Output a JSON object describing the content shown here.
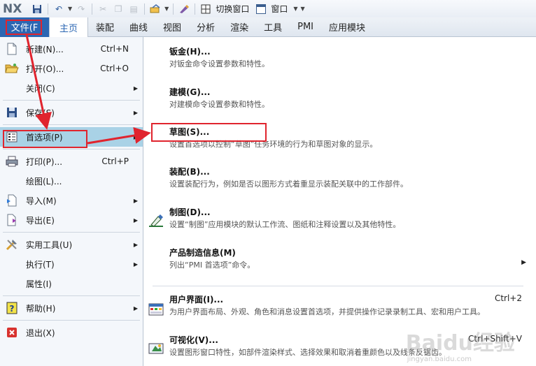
{
  "toolbar": {
    "logo": "NX",
    "switch_window_label": "切换窗口",
    "window_label": "窗口"
  },
  "tabs": {
    "file": "文件(F",
    "items": [
      "主页",
      "装配",
      "曲线",
      "视图",
      "分析",
      "渲染",
      "工具",
      "PMI",
      "应用模块"
    ]
  },
  "file_menu": {
    "items": [
      {
        "label": "新建(N)...",
        "shortcut": "Ctrl+N",
        "icon": "new-document-icon"
      },
      {
        "label": "打开(O)...",
        "shortcut": "Ctrl+O",
        "icon": "open-folder-icon"
      },
      {
        "label": "关闭(C)",
        "shortcut": "",
        "icon": ""
      },
      {
        "label": "保存(S)",
        "shortcut": "",
        "icon": "save-icon"
      },
      {
        "label": "首选项(P)",
        "shortcut": "",
        "icon": "preferences-icon"
      },
      {
        "label": "打印(P)...",
        "shortcut": "Ctrl+P",
        "icon": "print-icon"
      },
      {
        "label": "绘图(L)...",
        "shortcut": "",
        "icon": ""
      },
      {
        "label": "导入(M)",
        "shortcut": "",
        "icon": "import-icon"
      },
      {
        "label": "导出(E)",
        "shortcut": "",
        "icon": "export-icon"
      },
      {
        "label": "实用工具(U)",
        "shortcut": "",
        "icon": "utilities-icon"
      },
      {
        "label": "执行(T)",
        "shortcut": "",
        "icon": ""
      },
      {
        "label": "属性(I)",
        "shortcut": "",
        "icon": ""
      },
      {
        "label": "帮助(H)",
        "shortcut": "",
        "icon": "help-icon"
      },
      {
        "label": "退出(X)",
        "shortcut": "",
        "icon": "exit-icon"
      }
    ]
  },
  "submenu": {
    "items": [
      {
        "title": "钣金(H)...",
        "desc": "对钣金命令设置参数和特性。",
        "shortcut": ""
      },
      {
        "title": "建模(G)...",
        "desc": "对建模命令设置参数和特性。",
        "shortcut": ""
      },
      {
        "title": "草图(S)...",
        "desc": "设置首选项以控制“草图”任务环境的行为和草图对象的显示。",
        "shortcut": ""
      },
      {
        "title": "装配(B)...",
        "desc": "设置装配行为，例如是否以图形方式着重显示装配关联中的工作部件。",
        "shortcut": ""
      },
      {
        "title": "制图(D)...",
        "desc": "设置“制图”应用模块的默认工作流、图纸和注释设置以及其他特性。",
        "shortcut": ""
      },
      {
        "title": "产品制造信息(M)",
        "desc": "列出“PMI 首选项”命令。",
        "shortcut": ""
      },
      {
        "title": "用户界面(I)...",
        "desc": "为用户界面布局、外观、角色和消息设置首选项，并提供操作记录录制工具、宏和用户工具。",
        "shortcut": "Ctrl+2"
      },
      {
        "title": "可视化(V)...",
        "desc": "设置图形窗口特性，如部件渲染样式、选择效果和取消着重颜色以及线条反锯齿。",
        "shortcut": "Ctrl+Shift+V"
      }
    ]
  },
  "watermark": {
    "text": "Baidu经验",
    "sub": "jingyan.baidu.com"
  },
  "colors": {
    "accent": "#2c67b3",
    "highlight": "#a9d2e6",
    "annotation": "#e0242e"
  }
}
